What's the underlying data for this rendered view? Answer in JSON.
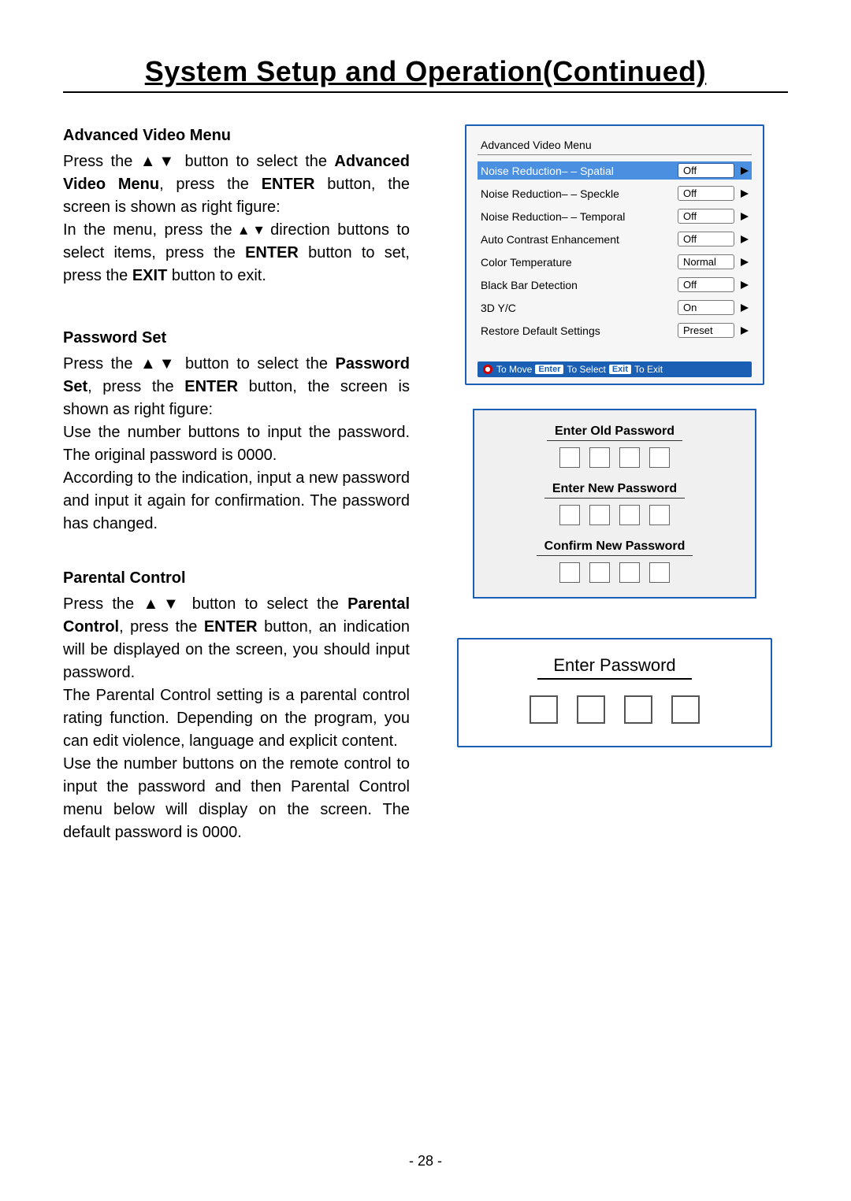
{
  "title": "System Setup and Operation(Continued)",
  "page_number": "- 28 -",
  "sections": {
    "advanced_video": {
      "heading": "Advanced Video Menu",
      "p1a": "Press the ",
      "p1b": " button to select the ",
      "p1c": "Advanced Video Menu",
      "p1d": ", press the ",
      "p1e": "ENTER",
      "p1f": " button, the screen is shown as right figure:",
      "p2a": "In the menu, press the ",
      "p2b": " direction buttons to select items, press the ",
      "p2c": "ENTER",
      "p2d": " button to set, press the ",
      "p2e": "EXIT",
      "p2f": " button to exit.",
      "tri_updown": "▲▼",
      "tri_small": "▴ ▾"
    },
    "password_set": {
      "heading": "Password Set",
      "p1a": "Press the ",
      "p1b": " button to select the ",
      "p1c": "Password Set",
      "p1d": ", press the ",
      "p1e": "ENTER",
      "p1f": " button, the screen is shown as right figure:",
      "p2": "Use the number buttons to input the password. The original password is 0000.",
      "p3": "According to the indication, input a new password and input it again for confirmation. The password has changed.",
      "tri_updown": "▲▼"
    },
    "parental_control": {
      "heading": "Parental Control",
      "p1a": "Press the ",
      "p1b": " button to select the ",
      "p1c": "Parental Control",
      "p1d": ", press the ",
      "p1e": "ENTER",
      "p1f": " button, an indication will be displayed on the screen, you should input password.",
      "p2": "The Parental Control setting is a parental control rating function. Depending on the program, you can edit violence, language and explicit content.",
      "p3": "Use the number buttons on the remote control to input the password and then Parental Control menu below will display on the screen. The default password is 0000.",
      "tri_updown": "▲▼"
    }
  },
  "menu": {
    "title": "Advanced Video Menu",
    "items": [
      {
        "label": "Noise Reduction– – Spatial",
        "value": "Off",
        "highlight": true
      },
      {
        "label": "Noise Reduction– – Speckle",
        "value": "Off",
        "highlight": false
      },
      {
        "label": "Noise Reduction– – Temporal",
        "value": "Off",
        "highlight": false
      },
      {
        "label": "Auto Contrast Enhancement",
        "value": "Off",
        "highlight": false
      },
      {
        "label": "Color Temperature",
        "value": "Normal",
        "highlight": false
      },
      {
        "label": "Black Bar Detection",
        "value": "Off",
        "highlight": false
      },
      {
        "label": "3D Y/C",
        "value": "On",
        "highlight": false
      },
      {
        "label": "Restore Default Settings",
        "value": "Preset",
        "highlight": false
      }
    ],
    "footer": {
      "move": "To Move",
      "enter_key": "Enter",
      "select": "To Select",
      "exit_key": "Exit",
      "exit": "To Exit"
    }
  },
  "password_panel": {
    "old": "Enter Old Password",
    "new": "Enter New Password",
    "confirm": "Confirm New Password"
  },
  "enter_password_panel": {
    "label": "Enter Password"
  }
}
